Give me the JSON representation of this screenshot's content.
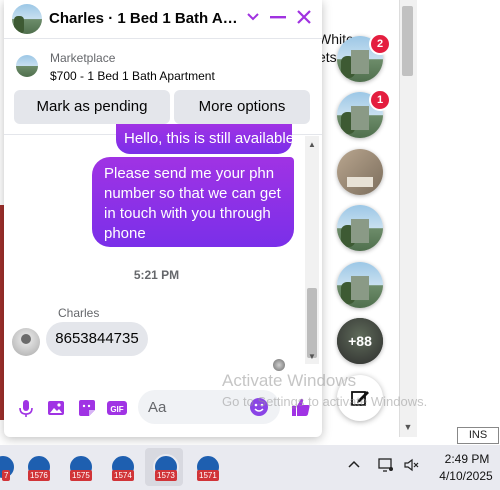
{
  "background": {
    "text_lines": [
      "White",
      "ets"
    ],
    "ins_label": "INS"
  },
  "chat": {
    "title": "Charles · 1 Bed 1 Bath Apartment",
    "listing": {
      "source_label": "Marketplace",
      "title": "$700 - 1 Bed 1 Bath Apartment",
      "mark_pending_label": "Mark as pending",
      "more_options_label": "More options"
    },
    "messages": [
      {
        "direction": "outgoing",
        "text": "Hello, this is still available"
      },
      {
        "direction": "outgoing",
        "text": "Please send me your phn number so that we can get in touch with you through phone"
      }
    ],
    "timestamp": "5:21 PM",
    "incoming": {
      "sender": "Charles",
      "text": "8653844735"
    },
    "composer": {
      "placeholder": "Aa"
    },
    "accent_color": "#a033e4"
  },
  "chat_heads": [
    {
      "badge": "2"
    },
    {
      "badge": "1"
    },
    {
      "badge": ""
    },
    {
      "badge": ""
    },
    {
      "badge": ""
    },
    {
      "label": "+88"
    }
  ],
  "watermark": {
    "title": "Activate Windows",
    "subtitle": "Go to Settings to activate Windows."
  },
  "taskbar": {
    "items": [
      "1576",
      "1575",
      "1574",
      "1573",
      "1571"
    ],
    "first_partial": "7",
    "time": "2:49 PM",
    "date": "4/10/2025"
  }
}
